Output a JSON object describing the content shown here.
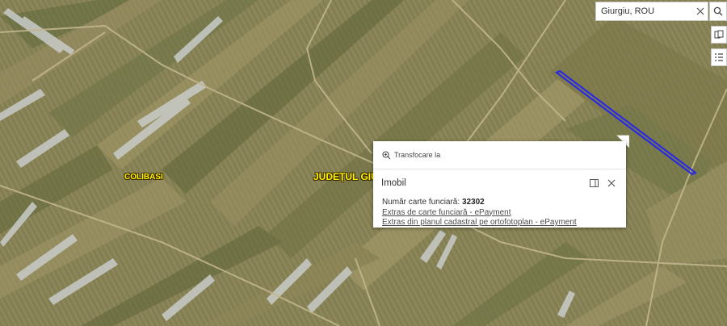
{
  "map": {
    "place_labels": {
      "village": "COLIBASI",
      "county": "JUDEȚUL GIUR"
    }
  },
  "search": {
    "value": "Giurgiu, ROU"
  },
  "icons": {
    "clear": "close-icon",
    "search": "search-icon",
    "layers": "layers-icon",
    "legend": "list-icon",
    "zoom": "zoom-in-icon",
    "dock": "dock-icon",
    "close": "close-icon"
  },
  "popup": {
    "zoom_action": "Transfocare la",
    "title": "Imobil",
    "cf_label": "Număr carte funciară: ",
    "cf_value": "32302",
    "links": [
      "Extras de carte funciară - ePayment",
      "Extras din planul cadastral pe ortofotoplan - ePayment"
    ]
  },
  "colors": {
    "highlight": "#2a2ae0",
    "label": "#fff200"
  }
}
